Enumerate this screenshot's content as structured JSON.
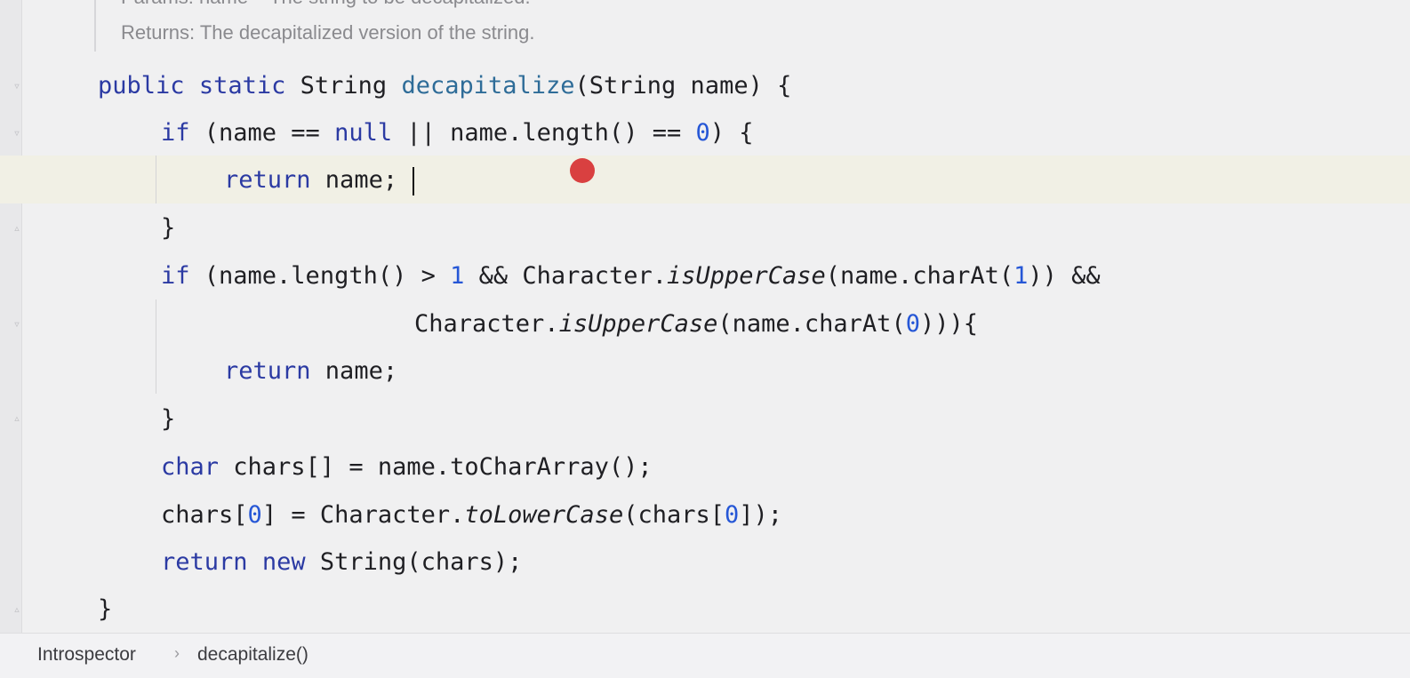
{
  "doc": {
    "params_line": "Params: name – The string to be decapitalized.",
    "returns_line": "Returns: The decapitalized version of the string."
  },
  "code": {
    "l1": {
      "kw1": "public",
      "kw2": "static",
      "type": "String",
      "method": "decapitalize",
      "rest": "(String name) {"
    },
    "l2": {
      "kw": "if",
      "a": " (name == ",
      "kw_null": "null",
      "b": " || name.length() == ",
      "num": "0",
      "c": ") {"
    },
    "l3": {
      "kw": "return",
      "rest": " name;"
    },
    "l4": {
      "text": "}"
    },
    "l5": {
      "kw": "if",
      "a": " (name.length() > ",
      "num": "1",
      "b": " && Character.",
      "static_call": "isUpperCase",
      "c": "(name.charAt(",
      "num2": "1",
      "d": ")) &&"
    },
    "l6": {
      "a": "Character.",
      "static_call": "isUpperCase",
      "b": "(name.charAt(",
      "num": "0",
      "c": "))){"
    },
    "l7": {
      "kw": "return",
      "rest": " name;"
    },
    "l8": {
      "text": "}"
    },
    "l9": {
      "kw": "char",
      "rest": " chars[] = name.toCharArray();"
    },
    "l10": {
      "a": "chars[",
      "num": "0",
      "b": "] = Character.",
      "static_call": "toLowerCase",
      "c": "(chars[",
      "num2": "0",
      "d": "]);"
    },
    "l11": {
      "kw": "return",
      "kw2": "new",
      "rest": " String(chars);"
    },
    "l12": {
      "text": "}"
    }
  },
  "breadcrumbs": {
    "class": "Introspector",
    "separator": "›",
    "method": "decapitalize()"
  },
  "colors": {
    "keyword": "#2b3aa3",
    "method_decl": "#2e6c98",
    "number": "#2657d6",
    "breakpoint": "#d94040",
    "current_line": "#f1f0e5"
  }
}
